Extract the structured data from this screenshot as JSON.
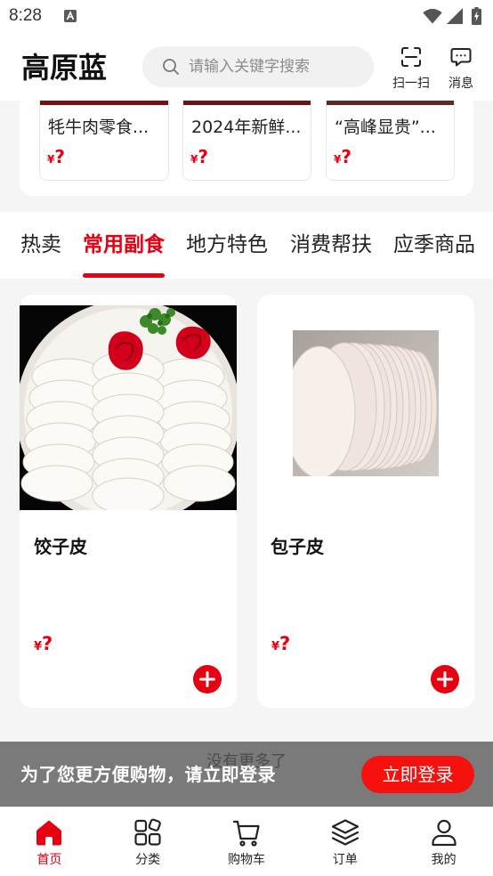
{
  "theme": {
    "accent": "#e60012",
    "button_background": "#f5120e",
    "page_background": "#f5f5f5",
    "card_background": "#ffffff",
    "text_primary": "#222222",
    "text_muted": "#999999",
    "banner_background": "rgba(0,0,0,0.5)"
  },
  "status_bar": {
    "time": "8:28",
    "icons": [
      "a-notification-icon",
      "wifi-icon",
      "cellular-signal-icon",
      "battery-charging-icon"
    ]
  },
  "header": {
    "title": "高原蓝",
    "search_placeholder": "请输入关键字搜索",
    "search_icon": "search-icon",
    "actions": [
      {
        "label": "扫一扫",
        "icon": "scan-icon"
      },
      {
        "label": "消息",
        "icon": "message-icon"
      }
    ]
  },
  "featured_products": [
    {
      "name": "牦牛肉零食...",
      "price_symbol": "¥",
      "price": "?"
    },
    {
      "name": "2024年新鲜...",
      "price_symbol": "¥",
      "price": "?"
    },
    {
      "name": "“高峰显贵”...",
      "price_symbol": "¥",
      "price": "?"
    }
  ],
  "tabs": {
    "active_index": 1,
    "items": [
      {
        "label": "热卖"
      },
      {
        "label": "常用副食"
      },
      {
        "label": "地方特色"
      },
      {
        "label": "消费帮扶"
      },
      {
        "label": "应季商品"
      }
    ]
  },
  "products": [
    {
      "name": "饺子皮",
      "price_symbol": "¥",
      "price": "?",
      "add_icon": "add-to-cart-plus-icon"
    },
    {
      "name": "包子皮",
      "price_symbol": "¥",
      "price": "?",
      "add_icon": "add-to-cart-plus-icon"
    }
  ],
  "list_end_text": "没有更多了",
  "login_banner": {
    "message": "为了您更方便购物，请立即登录",
    "button_label": "立即登录"
  },
  "bottom_nav": {
    "active_index": 0,
    "items": [
      {
        "label": "首页",
        "icon": "home-icon"
      },
      {
        "label": "分类",
        "icon": "category-grid-icon"
      },
      {
        "label": "购物车",
        "icon": "shopping-cart-icon"
      },
      {
        "label": "订单",
        "icon": "orders-layers-icon"
      },
      {
        "label": "我的",
        "icon": "user-profile-icon"
      }
    ]
  }
}
